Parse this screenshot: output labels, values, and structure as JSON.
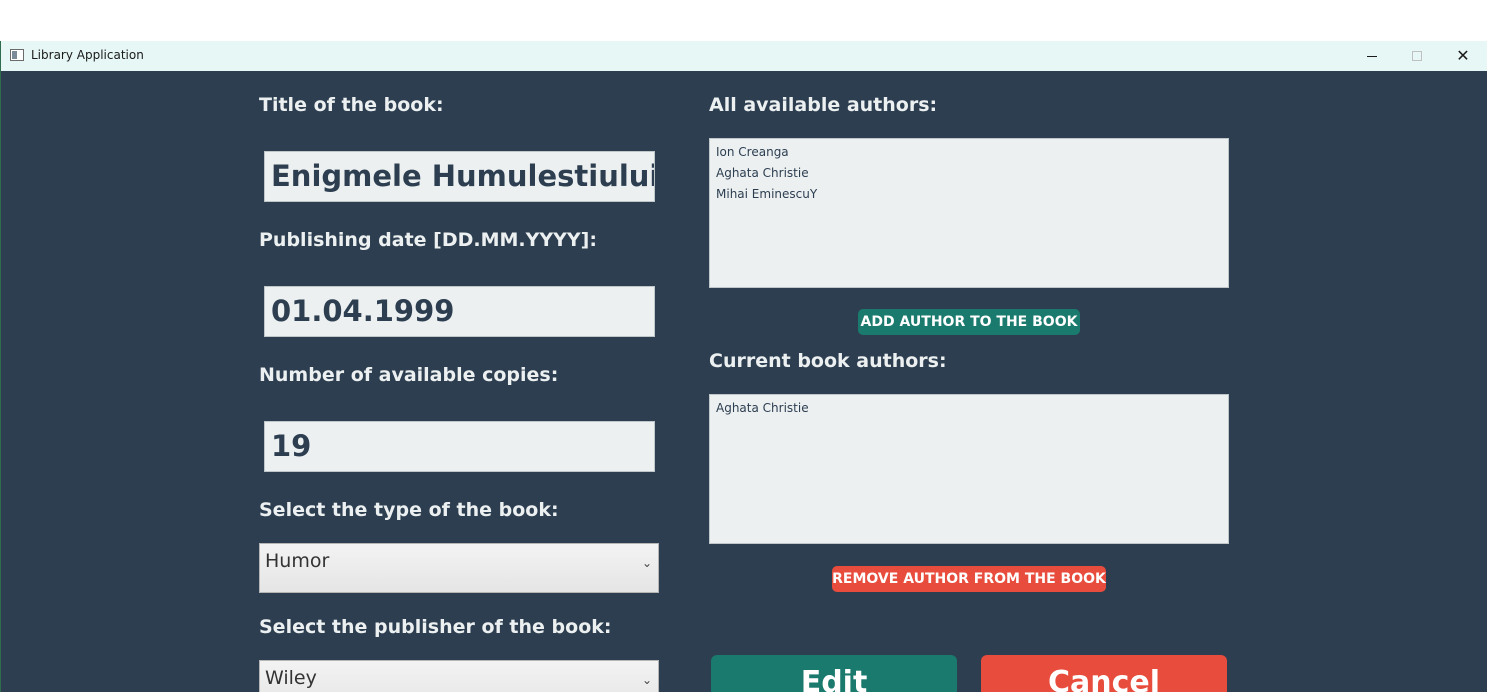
{
  "window": {
    "title": "Library Application",
    "close_glyph": "✕"
  },
  "form": {
    "title_label": "Title of the book:",
    "title_value": "Enigmele Humulestiului",
    "date_label": "Publishing date [DD.MM.YYYY]:",
    "date_value": "01.04.1999",
    "copies_label": "Number of available copies:",
    "copies_value": "19",
    "type_label": "Select the type of the book:",
    "type_value": "Humor",
    "publisher_label": "Select the publisher of the book:",
    "publisher_value": "Wiley",
    "dropdown_glyph": "⌄"
  },
  "authors": {
    "available_label": "All available authors:",
    "available_items": [
      "Ion Creanga",
      "Aghata Christie",
      "Mihai EminescuY"
    ],
    "add_button": "ADD AUTHOR TO THE BOOK",
    "current_label": "Current book authors:",
    "current_items": [
      "Aghata Christie"
    ],
    "remove_button": "REMOVE AUTHOR FROM THE BOOK"
  },
  "actions": {
    "edit": "Edit",
    "cancel": "Cancel"
  },
  "colors": {
    "background": "#2c3e50",
    "field": "#ecf0f1",
    "teal": "#1b7a6e",
    "red": "#e74c3c",
    "titlebar": "#e6f7f5"
  }
}
